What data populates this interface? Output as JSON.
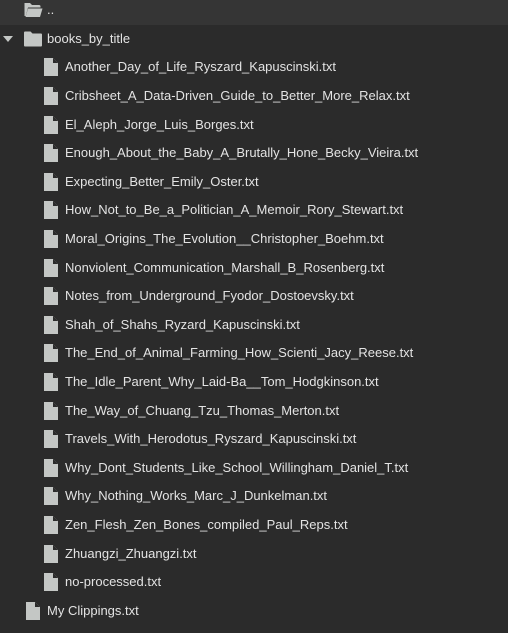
{
  "tree": {
    "parent_link": "..",
    "folder": {
      "name": "books_by_title",
      "expanded": true,
      "files": [
        "Another_Day_of_Life_Ryszard_Kapuscinski.txt",
        "Cribsheet_A_Data-Driven_Guide_to_Better_More_Relax.txt",
        "El_Aleph_Jorge_Luis_Borges.txt",
        "Enough_About_the_Baby_A_Brutally_Hone_Becky_Vieira.txt",
        "Expecting_Better_Emily_Oster.txt",
        "How_Not_to_Be_a_Politician_A_Memoir_Rory_Stewart.txt",
        "Moral_Origins_The_Evolution__Christopher_Boehm.txt",
        "Nonviolent_Communication_Marshall_B_Rosenberg.txt",
        "Notes_from_Underground_Fyodor_Dostoevsky.txt",
        "Shah_of_Shahs_Ryzard_Kapuscinski.txt",
        "The_End_of_Animal_Farming_How_Scienti_Jacy_Reese.txt",
        "The_Idle_Parent_Why_Laid-Ba__Tom_Hodgkinson.txt",
        "The_Way_of_Chuang_Tzu_Thomas_Merton.txt",
        "Travels_With_Herodotus_Ryszard_Kapuscinski.txt",
        "Why_Dont_Students_Like_School_Willingham_Daniel_T.txt",
        "Why_Nothing_Works_Marc_J_Dunkelman.txt",
        "Zen_Flesh_Zen_Bones_compiled_Paul_Reps.txt",
        "Zhuangzi_Zhuangzi.txt",
        "no-processed.txt"
      ]
    },
    "root_file": "My Clippings.txt"
  },
  "icons": {
    "folder_open": "folder-open-icon",
    "folder": "folder-icon",
    "file": "file-icon",
    "chevron": "chevron-down-icon"
  },
  "colors": {
    "background": "#2b2b2b",
    "text": "#e3e3e3",
    "icon": "#c4c7c5"
  }
}
